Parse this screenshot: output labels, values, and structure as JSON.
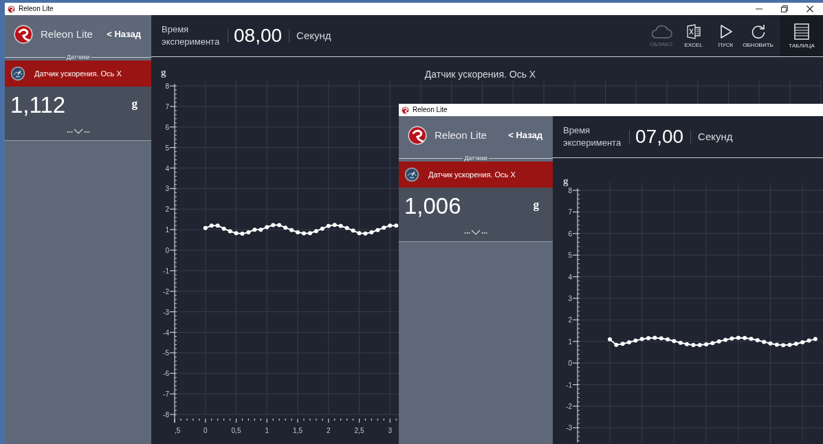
{
  "windows": [
    {
      "title": "Releon Lite",
      "has_controls": true,
      "app_name": "Releon Lite",
      "back": "< Назад",
      "sensors_label": "Датчики",
      "sensors": [
        {
          "name": "Датчик ускорения. Ось X",
          "selected": true,
          "value": "1,112",
          "unit": "g"
        }
      ],
      "time_label": "Время эксперимента",
      "time_value": "08,00",
      "time_unit": "Секунд",
      "toolbar": [
        {
          "kind": "cloud",
          "label": "ОБЛАКО",
          "disabled": true,
          "selected": false
        },
        {
          "kind": "excel",
          "label": "EXCEL",
          "disabled": false,
          "selected": false
        },
        {
          "kind": "play",
          "label": "ПУСК",
          "disabled": false,
          "selected": false
        },
        {
          "kind": "refresh",
          "label": "ОБНОВИТЬ",
          "disabled": false,
          "selected": false
        },
        {
          "kind": "table",
          "label": "ТАБЛИЦА",
          "disabled": false,
          "selected": true
        }
      ],
      "chart": {
        "kind": "data",
        "clipped_tick_label": ",5",
        "chart_data": {
          "type": "line",
          "title": "Датчик ускорения. Ось X",
          "ylabel": "g",
          "grid": true,
          "x": [
            0,
            0.1,
            0.2,
            0.3,
            0.4,
            0.5,
            0.6,
            0.7,
            0.8,
            0.9,
            1,
            1.1,
            1.2,
            1.3,
            1.4,
            1.5,
            1.6,
            1.7,
            1.8,
            1.9,
            2,
            2.1,
            2.2,
            2.3,
            2.4,
            2.5,
            2.6,
            2.7,
            2.8,
            2.9,
            3,
            3.1
          ],
          "series": [
            {
              "color": "#ffffff",
              "marker": "circle",
              "values": [
                1.08,
                1.2,
                1.2,
                1.05,
                0.92,
                0.83,
                0.8,
                0.87,
                1.0,
                1.0,
                1.12,
                1.22,
                1.22,
                1.1,
                0.98,
                0.87,
                0.82,
                0.83,
                0.93,
                1.05,
                1.18,
                1.23,
                1.18,
                1.08,
                0.95,
                0.83,
                0.81,
                0.87,
                0.98,
                1.1,
                1.2,
                1.2
              ]
            }
          ],
          "xlim": [
            -0.5,
            10
          ],
          "ylim": [
            -8,
            8
          ],
          "xticks": [
            0,
            {
              "value": 0.5,
              "label": "0,5"
            },
            1,
            {
              "value": 1.5,
              "label": "1,5"
            },
            2,
            {
              "value": 2.5,
              "label": "2,5"
            },
            3
          ],
          "yticks": [
            -8,
            -7,
            -6,
            -5,
            -4,
            -3,
            -2,
            -1,
            0,
            1,
            2,
            3,
            4,
            5,
            6,
            7,
            8
          ]
        }
      }
    },
    {
      "title": "Releon Lite",
      "has_controls": false,
      "app_name": "Releon Lite",
      "back": "< Назад",
      "sensors_label": "Датчики",
      "sensors": [
        {
          "name": "Датчик ускорения. Ось X",
          "selected": true,
          "value": "1,006",
          "unit": "g"
        }
      ],
      "time_label": "Время эксперимента",
      "time_value": "07,00",
      "time_unit": "Секунд",
      "chart": {
        "kind": "picture",
        "unit": "g",
        "y_tick_labels": [
          "8",
          "7",
          "6",
          "5",
          "4",
          "3",
          "2",
          "1",
          "0",
          "-1",
          "-2",
          "-3"
        ]
      }
    }
  ]
}
